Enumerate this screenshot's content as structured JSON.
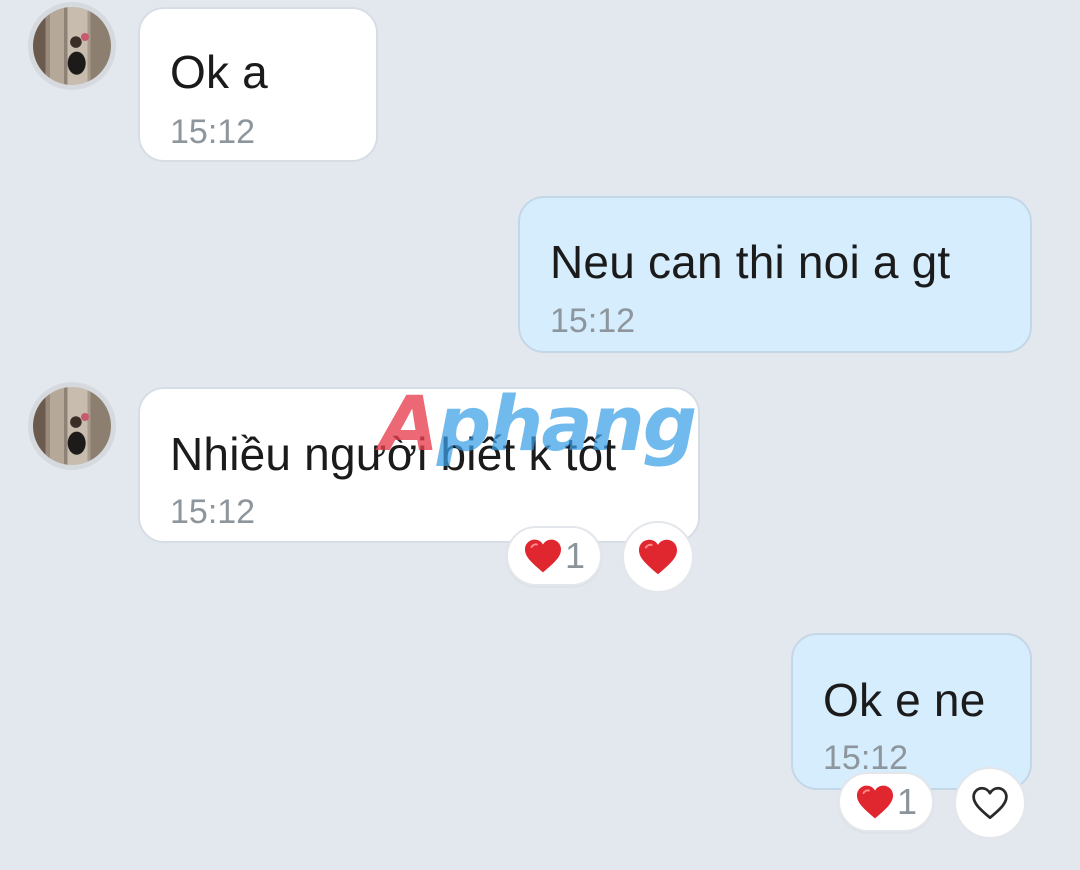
{
  "messages": [
    {
      "sender": "other",
      "text": "Ok a",
      "time": "15:12"
    },
    {
      "sender": "me",
      "text": "Neu can thi noi a gt",
      "time": "15:12"
    },
    {
      "sender": "other",
      "text": "Nhiều người biết k tốt",
      "time": "15:12",
      "reaction_count": "1",
      "reaction_button": "heart-filled"
    },
    {
      "sender": "me",
      "text": "Ok e ne",
      "time": "15:12",
      "reaction_count": "1",
      "reaction_button": "heart-outline"
    }
  ],
  "watermark": {
    "first": "A",
    "rest": "phang"
  },
  "colors": {
    "background": "#e3e8ef",
    "incoming_bubble": "#ffffff",
    "outgoing_bubble": "#d5edfd",
    "heart": "#e0262f",
    "time_text": "#8d959d"
  }
}
